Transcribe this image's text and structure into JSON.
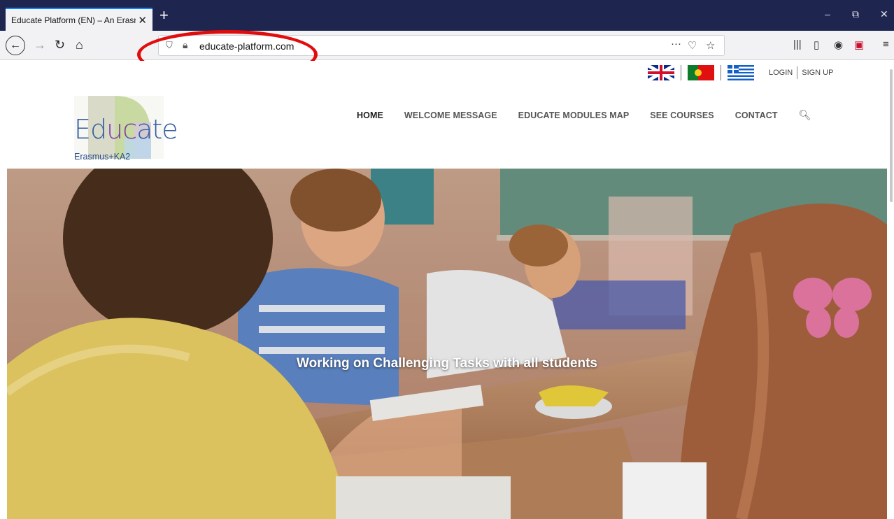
{
  "browser": {
    "tab_title": "Educate Platform (EN) – An Erasmus",
    "tab_close": "✕",
    "new_tab": "+",
    "url": "educate-platform.com",
    "page_actions": "···",
    "minimize": "–",
    "restore": "⧉",
    "close": "✕"
  },
  "site": {
    "auth": {
      "login": "LOGIN",
      "signup": "SIGN UP"
    },
    "logo": {
      "word_start": "Ed",
      "word_mid": "uc",
      "word_end": "ate",
      "sub": "Erasmus+KA2"
    },
    "nav": [
      "HOME",
      "WELCOME MESSAGE",
      "EDUCATE MODULES MAP",
      "SEE COURSES",
      "CONTACT"
    ],
    "hero_caption": "Working on Challenging Tasks with all students"
  },
  "colors": {
    "tabstrip": "#1e2650",
    "annotation": "#e10c0c",
    "logo_blue": "#355fa0",
    "logo_purple": "#7a3fa0"
  }
}
